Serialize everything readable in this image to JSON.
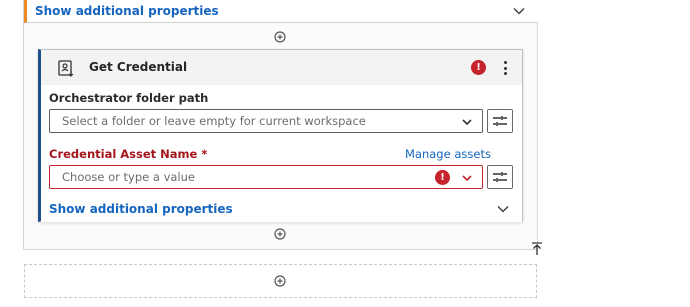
{
  "top_section": {
    "show_more_label": "Show additional properties"
  },
  "activity": {
    "title": "Get Credential",
    "error_symbol": "!",
    "folder_field": {
      "label": "Orchestrator folder path",
      "placeholder": "Select a folder or leave empty for current workspace"
    },
    "credential_field": {
      "label": "Credential Asset Name *",
      "placeholder": "Choose or type a value",
      "error_symbol": "!"
    },
    "manage_link": "Manage assets",
    "show_more_label": "Show additional properties"
  },
  "colors": {
    "accent_orange": "#f08a24",
    "link_blue": "#1565c0",
    "card_border_blue": "#1f4e8c",
    "error_red": "#c7232c"
  },
  "icons": [
    "chevron-down-icon",
    "add-circle-icon",
    "credential-icon",
    "error-icon",
    "more-vert-icon",
    "variable-picker-icon",
    "scroll-to-top-icon"
  ]
}
